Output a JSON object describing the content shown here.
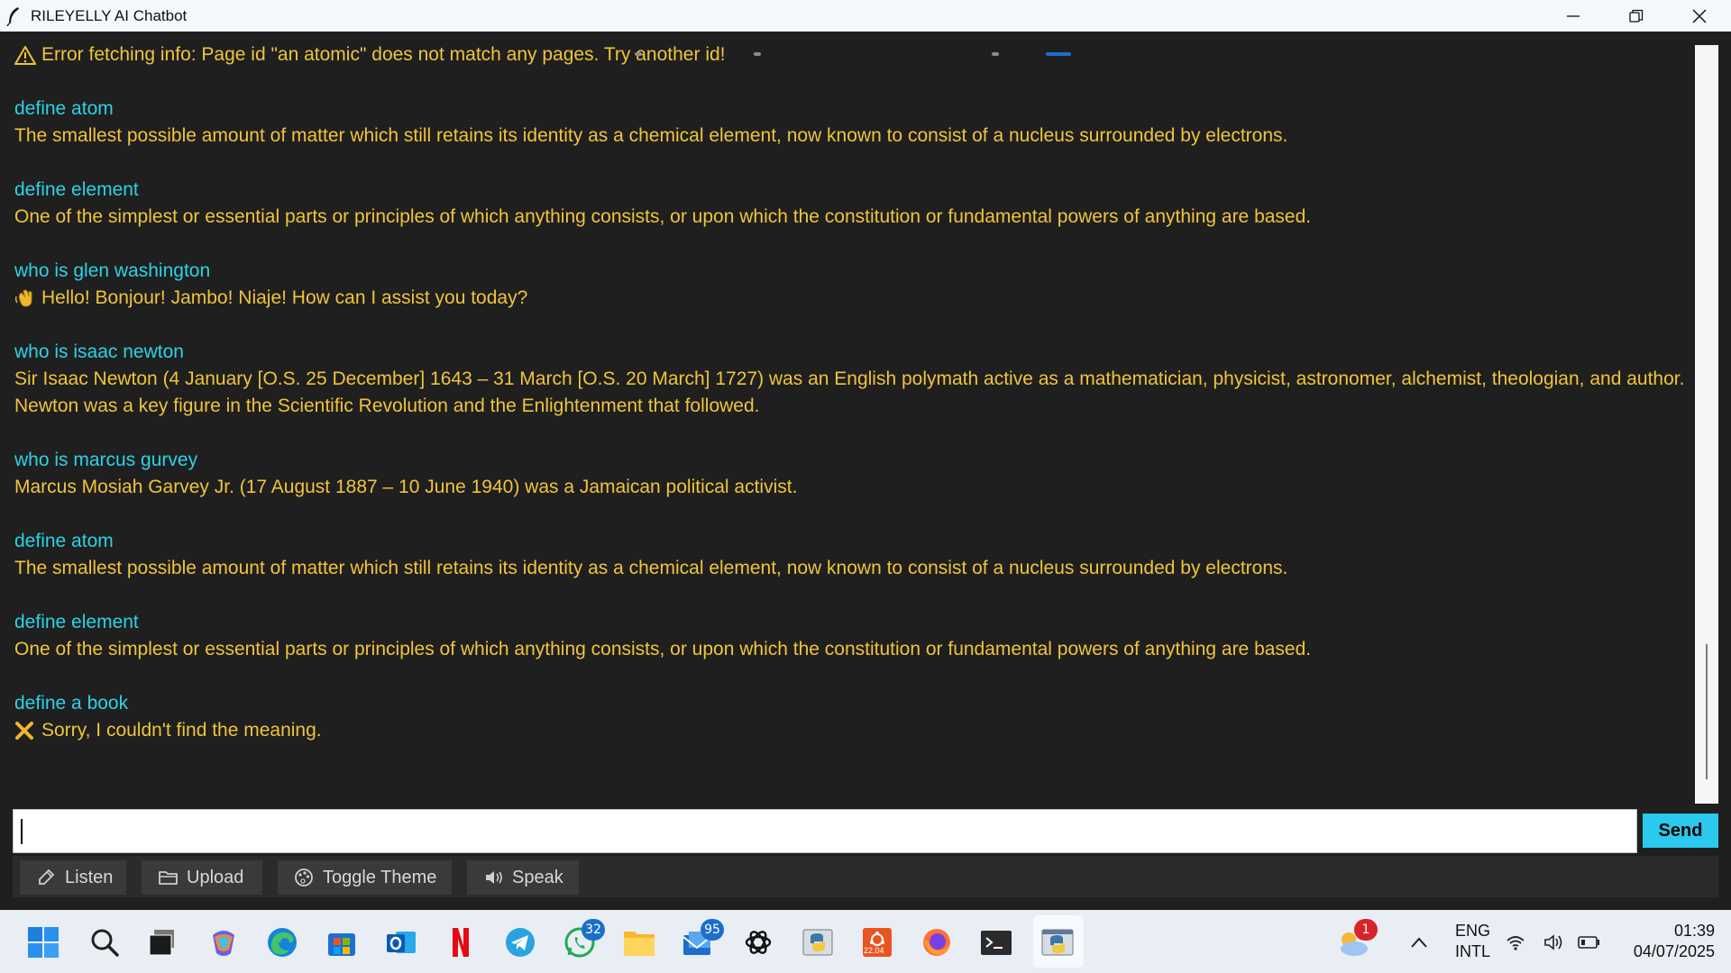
{
  "window": {
    "title": "RILEYELLY AI Chatbot"
  },
  "chat": {
    "error_line": "Error fetching info: Page id \"an atomic\" does not match any pages. Try another id!",
    "messages": [
      {
        "user": "define atom",
        "bot": "The smallest possible amount of matter which still retains its identity as a chemical element, now known to consist of a nucleus surrounded by electrons.",
        "icon": ""
      },
      {
        "user": "define element",
        "bot": "One of the simplest or essential parts or principles of which anything consists, or upon which the constitution or fundamental powers of anything are based.",
        "icon": ""
      },
      {
        "user": "who is glen washington",
        "bot": "Hello! Bonjour! Jambo! Niaje! How can I assist you today?",
        "icon": "wave-icon"
      },
      {
        "user": "who is isaac newton",
        "bot": "Sir Isaac Newton (4 January [O.S. 25 December] 1643 – 31 March [O.S. 20 March] 1727) was an English polymath active as a mathematician, physicist, astronomer, alchemist, theologian, and author. Newton was a key figure in the Scientific Revolution and the Enlightenment that followed.",
        "icon": ""
      },
      {
        "user": "who is marcus gurvey",
        "bot": "Marcus Mosiah Garvey Jr.  (17 August 1887 – 10 June 1940) was a Jamaican political activist.",
        "icon": ""
      },
      {
        "user": "define atom",
        "bot": "The smallest possible amount of matter which still retains its identity as a chemical element, now known to consist of a nucleus surrounded by electrons.",
        "icon": ""
      },
      {
        "user": "define element",
        "bot": "One of the simplest or essential parts or principles of which anything consists, or upon which the constitution or fundamental powers of anything are based.",
        "icon": ""
      },
      {
        "user": "define a book",
        "bot": "Sorry, I couldn't find the meaning.",
        "icon": "cross-icon"
      }
    ]
  },
  "input": {
    "value": "",
    "send_label": "Send"
  },
  "toolbar": {
    "listen_label": "Listen",
    "upload_label": "Upload",
    "toggle_theme_label": "Toggle Theme",
    "speak_label": "Speak"
  },
  "taskbar": {
    "whatsapp_badge": "32",
    "outlook_badge": "95",
    "ubuntu_label": "22.04",
    "weather_badge": "1",
    "lang_line1": "ENG",
    "lang_line2": "INTL",
    "time": "01:39",
    "date": "04/07/2025"
  },
  "colors": {
    "user_text": "#2bd3e6",
    "bot_text": "#f0c43a",
    "background": "#1f1f1f",
    "send_button": "#2bc9ee"
  }
}
